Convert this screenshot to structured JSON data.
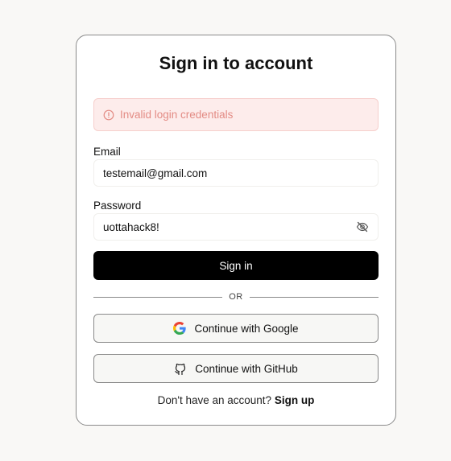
{
  "card": {
    "title": "Sign in to account"
  },
  "alert": {
    "icon": "alert-circle-icon",
    "message": "Invalid login credentials",
    "color": "#e38b84"
  },
  "email": {
    "label": "Email",
    "value": "testemail@gmail.com"
  },
  "password": {
    "label": "Password",
    "value": "uottahack8!",
    "toggle_icon": "eye-off-icon"
  },
  "actions": {
    "sign_in_label": "Sign in",
    "divider_label": "OR",
    "google_label": "Continue with Google",
    "google_icon": "google-icon",
    "github_label": "Continue with GitHub",
    "github_icon": "github-icon"
  },
  "footer": {
    "prompt": "Don't have an account?",
    "signup_label": "Sign up"
  },
  "colors": {
    "primary": "#000000",
    "background": "#f9f8f6",
    "alert_background": "#fdeceb"
  }
}
